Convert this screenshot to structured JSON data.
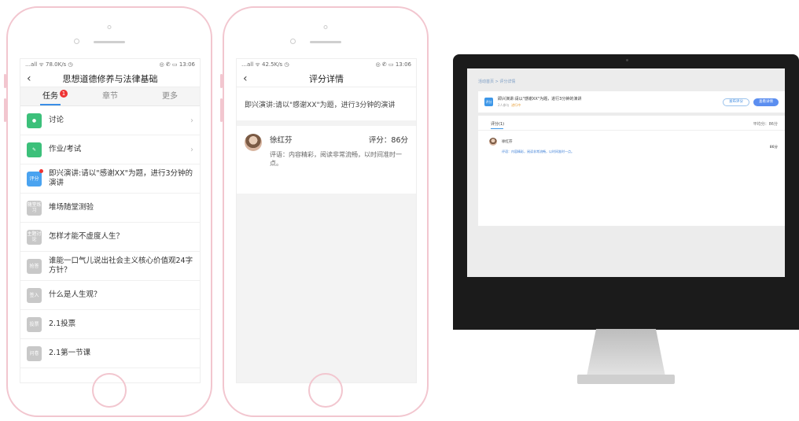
{
  "phone1": {
    "status_left": "…all ᯤ 78.0K/s ◷",
    "status_right": "◎ ✆ ▭ 13:06",
    "title": "思想道德修养与法律基础",
    "back_icon": "chevron-left-icon",
    "tabs": [
      {
        "label": "任务",
        "badge": "1"
      },
      {
        "label": "章节"
      },
      {
        "label": "更多"
      }
    ],
    "items": [
      {
        "icon": "chat-icon",
        "icon_label": "",
        "color": "#3cc07a",
        "label": "讨论",
        "arrow": "›"
      },
      {
        "icon": "edit-icon",
        "icon_label": "",
        "color": "#3cc07a",
        "label": "作业/考试",
        "arrow": "›"
      },
      {
        "icon": "score-icon",
        "icon_label": "评分",
        "color": "#4aa3f0",
        "label": "即兴演讲:请以\"感谢XX\"为题，进行3分钟的演讲"
      },
      {
        "icon": "quiz-icon",
        "icon_label": "随堂练习",
        "color": "#c8c8c8",
        "label": "堆场随堂测验"
      },
      {
        "icon": "vote-icon",
        "icon_label": "主题讨论",
        "color": "#c8c8c8",
        "label": "怎样才能不虚度人生？"
      },
      {
        "icon": "rush-icon",
        "icon_label": "抢答",
        "color": "#c8c8c8",
        "label": "谁能一口气儿说出社会主义核心价值观24字方针？"
      },
      {
        "icon": "signin-icon",
        "icon_label": "签入",
        "color": "#c8c8c8",
        "label": "什么是人生观？"
      },
      {
        "icon": "vote2-icon",
        "icon_label": "投票",
        "color": "#c8c8c8",
        "label": "2.1投票"
      },
      {
        "icon": "survey-icon",
        "icon_label": "问卷",
        "color": "#c8c8c8",
        "label": "2.1第一节课"
      }
    ]
  },
  "phone2": {
    "status_left": "…all ᯤ 42.5K/s ◷",
    "status_right": "◎ ✆ ▭ 13:06",
    "title": "评分详情",
    "topic": "即兴演讲:请以\"感谢XX\"为题，进行3分钟的演讲",
    "comment": {
      "name": "徐红芬",
      "score": "评分：86分",
      "text": "评语：内容精彩，阅读非常流畅，以时间准时一点。"
    }
  },
  "monitor": {
    "breadcrumb": "活动首页 > 评分详情",
    "card_icon_label": "评分",
    "card_title": "即兴演讲:请以\"感谢XX\"为题，进行3分钟的演讲",
    "card_meta_a": "2人参与",
    "card_meta_b": "进行中",
    "btn_secondary": "发布评分",
    "btn_primary": "查看详情",
    "tab_label": "评分(1)",
    "score_summary": "平均分：86分",
    "comment_name": "徐红芬",
    "comment_score": "86分",
    "comment_text": "评语：内容精彩，阅读非常流畅，以时间准时一点。"
  }
}
